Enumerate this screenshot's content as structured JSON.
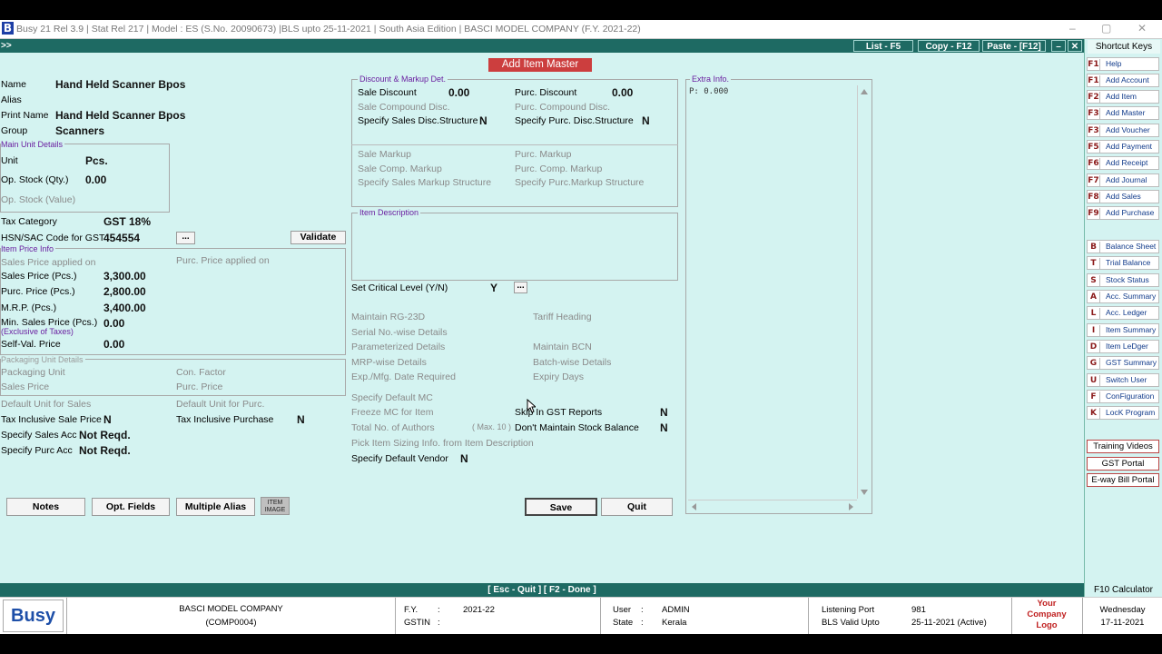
{
  "window": {
    "logo": "B",
    "title": "Busy 21  Rel 3.9  |  Stat Rel 217  |  Model : ES (S.No. 20090673)  |BLS upto 25-11-2021  |  South Asia Edition  |  BASCI MODEL COMPANY (F.Y. 2021-22)",
    "min": "–",
    "max": "▢",
    "close": "✕"
  },
  "menubar": {
    "expand": ">>",
    "list": "List - F5",
    "copy": "Copy - F12",
    "paste": "Paste - [F12]",
    "min": "–",
    "max": "▢",
    "close": "✕"
  },
  "form": {
    "header": "Add Item Master",
    "name_label": "Name",
    "name_value": "Hand Held Scanner Bpos",
    "alias_label": "Alias",
    "print_label": "Print Name",
    "print_value": "Hand Held Scanner Bpos",
    "group_label": "Group",
    "group_value": "Scanners",
    "main_unit_title": "Main Unit Details",
    "unit_label": "Unit",
    "unit_value": "Pcs.",
    "opstock_qty_label": "Op. Stock (Qty.)",
    "opstock_qty_value": "0.00",
    "opstock_val_label": "Op. Stock (Value)",
    "tax_label": "Tax Category",
    "tax_value": "GST 18%",
    "hsn_label": "HSN/SAC Code for GST",
    "hsn_value": "454554",
    "hsn_more": "...",
    "validate": "Validate",
    "price_title": "Item Price Info",
    "sales_applied": "Sales Price applied on",
    "purc_applied": "Purc. Price applied on",
    "sales_price_label": "Sales Price (Pcs.)",
    "sales_price": "3,300.00",
    "purc_price_label": "Purc. Price (Pcs.)",
    "purc_price": "2,800.00",
    "mrp_label": "M.R.P. (Pcs.)",
    "mrp": "3,400.00",
    "min_sales_label": "Min. Sales Price (Pcs.)",
    "min_sales_note": "(Exclusive of Taxes)",
    "min_sales": "0.00",
    "selfval_label": "Self-Val. Price",
    "selfval": "0.00",
    "pack_title": "Packaging Unit Details",
    "pack_unit": "Packaging Unit",
    "con_factor": "Con. Factor",
    "pack_sales": "Sales Price",
    "pack_purc": "Purc. Price",
    "def_unit_sales": "Default Unit for Sales",
    "def_unit_purc": "Default Unit for Purc.",
    "tax_incl_sale_label": "Tax Inclusive Sale Price",
    "tax_incl_sale": "N",
    "tax_incl_purc_label": "Tax Inclusive Purchase",
    "tax_incl_purc": "N",
    "sales_acc_label": "Specify Sales Acc",
    "sales_acc": "Not Reqd.",
    "purc_acc_label": "Specify Purc Acc",
    "purc_acc": "Not Reqd."
  },
  "discount": {
    "title": "Discount & Markup Det.",
    "sale_disc_label": "Sale Discount",
    "sale_disc": "0.00",
    "purc_disc_label": "Purc. Discount",
    "purc_disc": "0.00",
    "sale_comp": "Sale Compound Disc.",
    "purc_comp": "Purc. Compound Disc.",
    "sales_struct_label": "Specify Sales Disc.Structure",
    "sales_struct": "N",
    "purc_struct_label": "Specify  Purc. Disc.Structure",
    "purc_struct": "N",
    "sale_markup": "Sale Markup",
    "purc_markup": "Purc. Markup",
    "sale_comp_markup": "Sale Comp. Markup",
    "purc_comp_markup": "Purc. Comp. Markup",
    "sales_markup_struct": "Specify Sales Markup Structure",
    "purc_markup_struct": "Specify  Purc.Markup Structure"
  },
  "desc": {
    "title": "Item Description"
  },
  "critical": {
    "label": "Set Critical Level (Y/N)",
    "value": "Y",
    "more": "..."
  },
  "options": {
    "rg23d": "Maintain RG-23D",
    "tariff": "Tariff Heading",
    "serial": "Serial No.-wise Details",
    "param": "Parameterized Details",
    "bcn": "Maintain BCN",
    "mrp": "MRP-wise Details",
    "batch": "Batch-wise Details",
    "expmfg": "Exp./Mfg. Date Required",
    "expiry": "Expiry Days",
    "default_mc": "Specify Default MC",
    "freeze_mc": "Freeze MC for Item",
    "skip_gst_label": "Skip In GST Reports",
    "skip_gst": "N",
    "authors": "Total No. of Authors",
    "max": "( Max. 10 )",
    "stock_bal_label": "Don't Maintain Stock Balance",
    "stock_bal": "N",
    "sizing": "Pick Item Sizing Info. from Item Description",
    "vendor_label": "Specify Default Vendor",
    "vendor": "N"
  },
  "extra": {
    "title": "Extra Info.",
    "text": "P: 0.000"
  },
  "buttons": {
    "notes": "Notes",
    "opt_fields": "Opt. Fields",
    "multi_alias": "Multiple Alias",
    "item_image": "ITEM IMAGE",
    "save": "Save",
    "quit": "Quit"
  },
  "shortcuts": {
    "title": "Shortcut Keys",
    "items": [
      {
        "k": "F1",
        "l": "Help"
      },
      {
        "k": "F1",
        "l": "Add Account"
      },
      {
        "k": "F2",
        "l": "Add Item"
      },
      {
        "k": "F3",
        "l": "Add Master"
      },
      {
        "k": "F3",
        "l": "Add Voucher"
      },
      {
        "k": "F5",
        "l": "Add Payment"
      },
      {
        "k": "F6",
        "l": "Add Receipt"
      },
      {
        "k": "F7",
        "l": "Add Journal"
      },
      {
        "k": "F8",
        "l": "Add Sales"
      },
      {
        "k": "F9",
        "l": "Add Purchase"
      },
      {
        "k": "B",
        "l": "Balance Sheet"
      },
      {
        "k": "T",
        "l": "Trial Balance"
      },
      {
        "k": "S",
        "l": "Stock Status"
      },
      {
        "k": "A",
        "l": "Acc. Summary"
      },
      {
        "k": "L",
        "l": "Acc. Ledger"
      },
      {
        "k": "I",
        "l": "Item Summary"
      },
      {
        "k": "D",
        "l": "Item LeDger"
      },
      {
        "k": "G",
        "l": "GST Summary"
      },
      {
        "k": "U",
        "l": "Switch User"
      },
      {
        "k": "F",
        "l": "ConFiguration"
      },
      {
        "k": "K",
        "l": "LocK Program"
      }
    ],
    "training": "Training Videos",
    "gst_portal": "GST Portal",
    "eway": "E-way Bill Portal",
    "calc": "F10 Calculator"
  },
  "status": {
    "text": "[ Esc - Quit ]    [ F2 - Done ]"
  },
  "footer": {
    "brand": "Busy",
    "company": "BASCI MODEL COMPANY",
    "code": "(COMP0004)",
    "fy_label": "F.Y.",
    "fy": "2021-22",
    "gstin_label": "GSTIN",
    "sep": ":",
    "user_label": "User",
    "user": "ADMIN",
    "state_label": "State",
    "state": "Kerala",
    "port_label": "Listening Port",
    "port": "981",
    "valid_label": "BLS Valid Upto",
    "valid": "25-11-2021 (Active)",
    "logo_text": "Your Company Logo",
    "day": "Wednesday",
    "date": "17-11-2021"
  },
  "colors": {
    "accent": "#1e6a63",
    "header": "#cc3e3e",
    "background": "#d4f3f1"
  }
}
